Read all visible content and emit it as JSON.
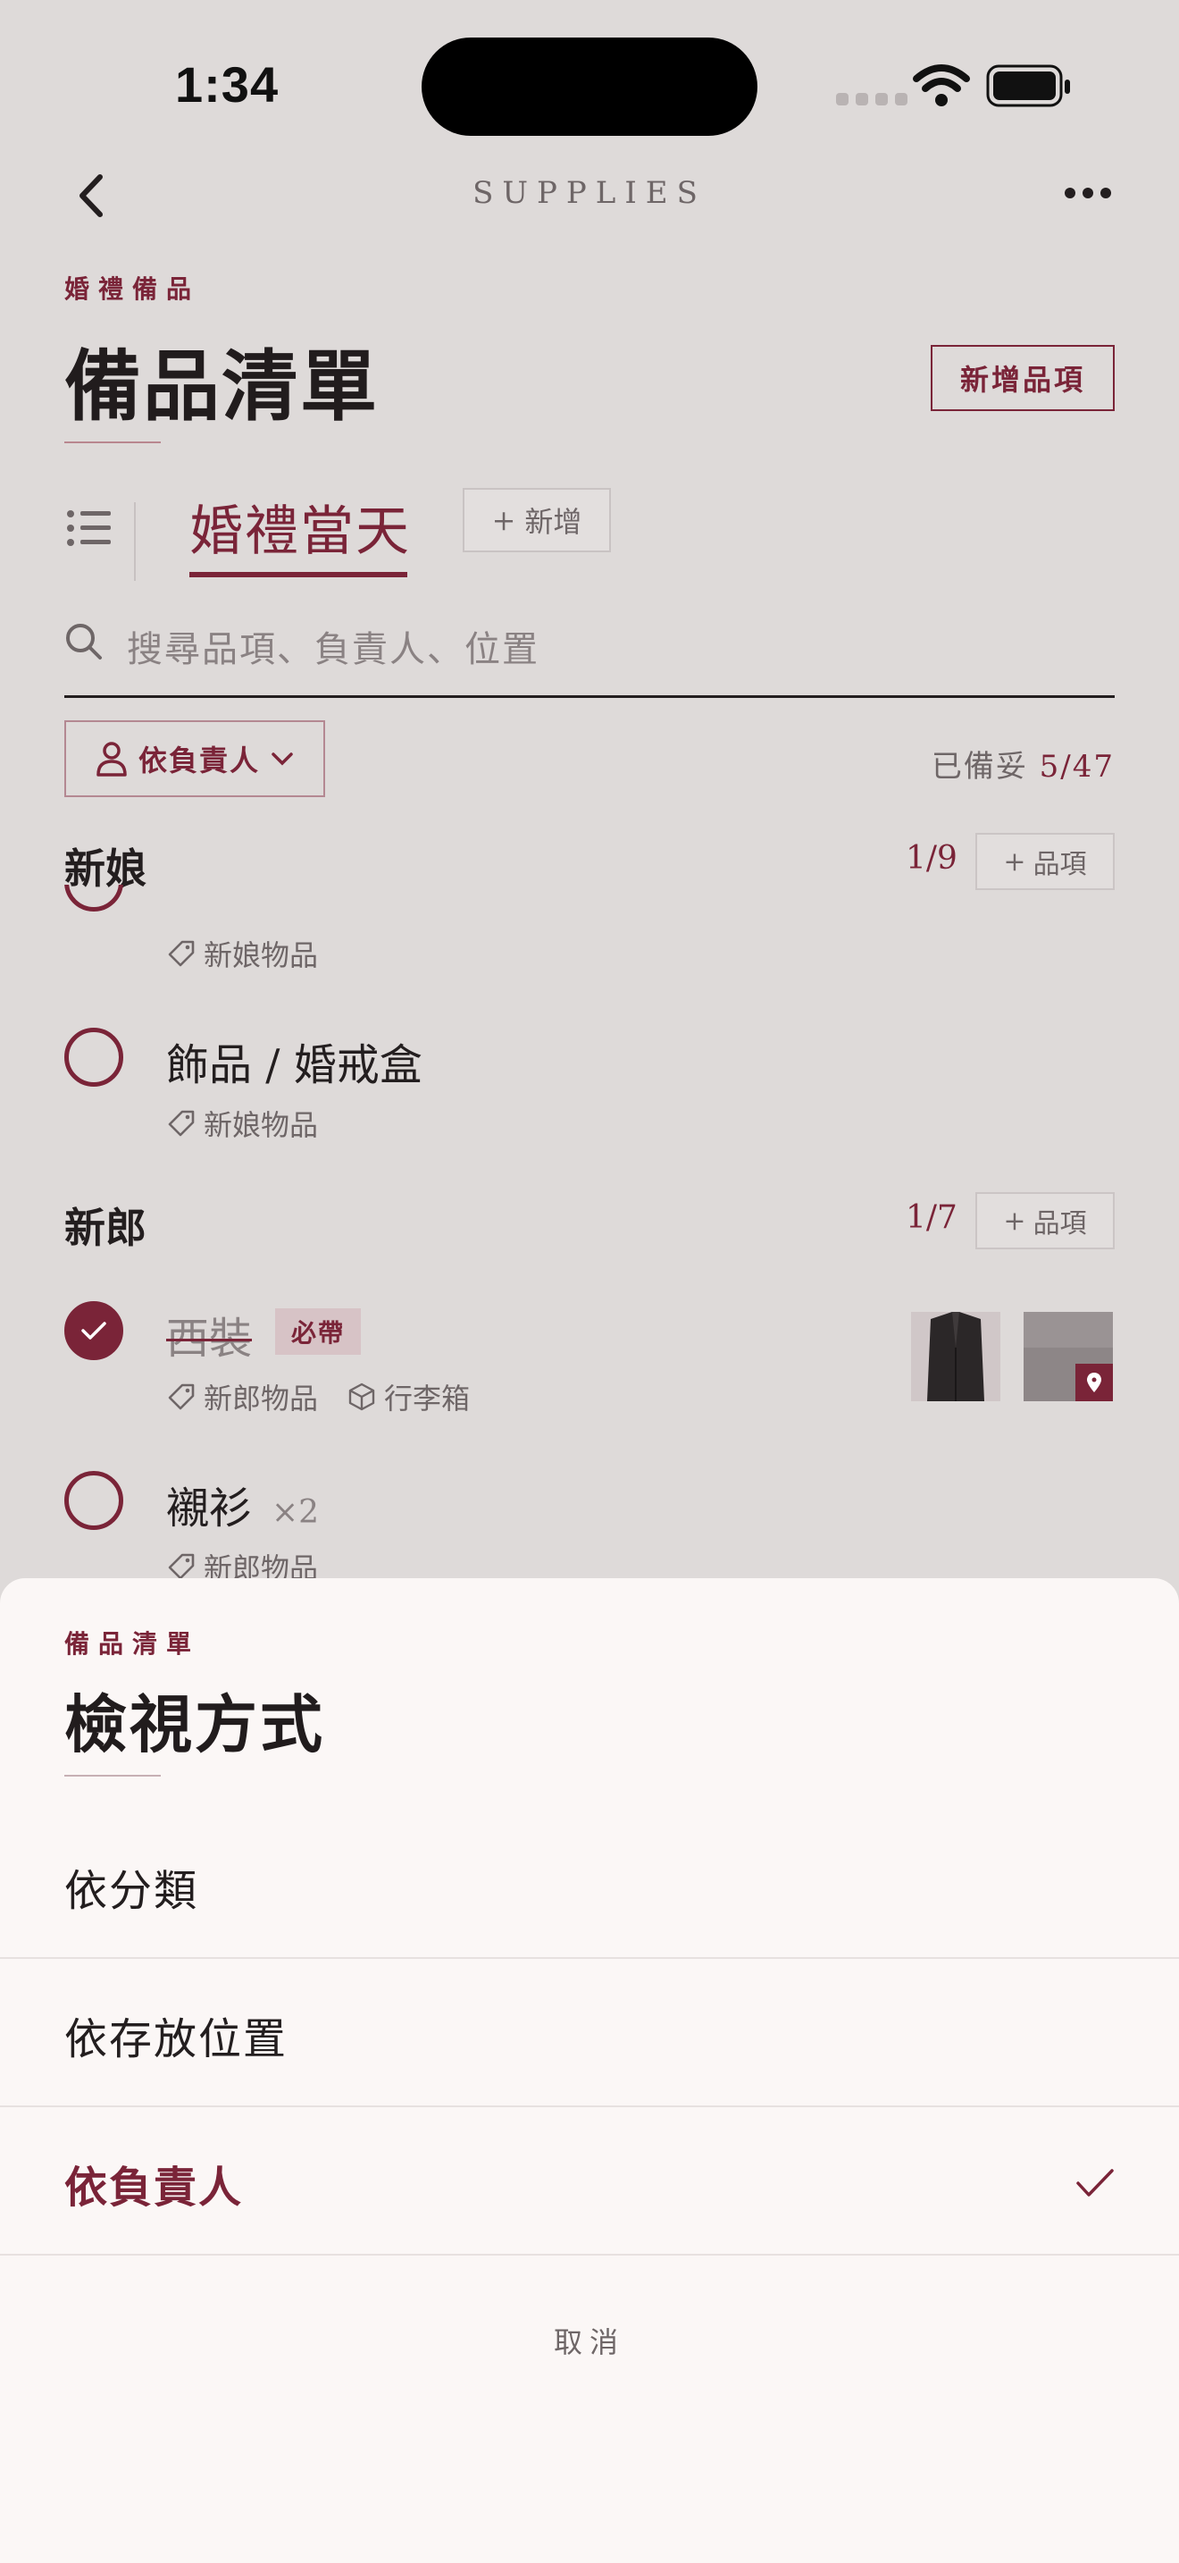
{
  "status_bar": {
    "time": "1:34"
  },
  "nav": {
    "title": "SUPPLIES"
  },
  "header": {
    "eyebrow": "婚禮備品",
    "title": "備品清單",
    "add_button": "新增品項"
  },
  "tabs": {
    "active_label": "婚禮當天",
    "add_label": "新增"
  },
  "search": {
    "placeholder": "搜尋品項、負責人、位置"
  },
  "filter": {
    "label": "依負責人"
  },
  "ready": {
    "label": "已備妥",
    "value": "5/47"
  },
  "sections": [
    {
      "title": "新娘",
      "count": "1/9",
      "add_label": "品項",
      "items": [
        {
          "name": "",
          "tags": [
            "新娘物品"
          ],
          "done": false
        },
        {
          "name": "飾品 / 婚戒盒",
          "tags": [
            "新娘物品"
          ],
          "done": false
        }
      ]
    },
    {
      "title": "新郎",
      "count": "1/7",
      "add_label": "品項",
      "items": [
        {
          "name": "西裝",
          "badge": "必帶",
          "tags": [
            "新郎物品"
          ],
          "location": "行李箱",
          "done": true
        },
        {
          "name": "襯衫",
          "qty": "×2",
          "tags": [
            "新郎物品"
          ],
          "done": false
        }
      ]
    }
  ],
  "sheet": {
    "eyebrow": "備品清單",
    "title": "檢視方式",
    "options": [
      "依分類",
      "依存放位置",
      "依負責人"
    ],
    "selected": "依負責人",
    "cancel": "取消"
  },
  "colors": {
    "accent": "#7a2438",
    "background": "#dedad9",
    "sheet": "#fbf7f6"
  }
}
